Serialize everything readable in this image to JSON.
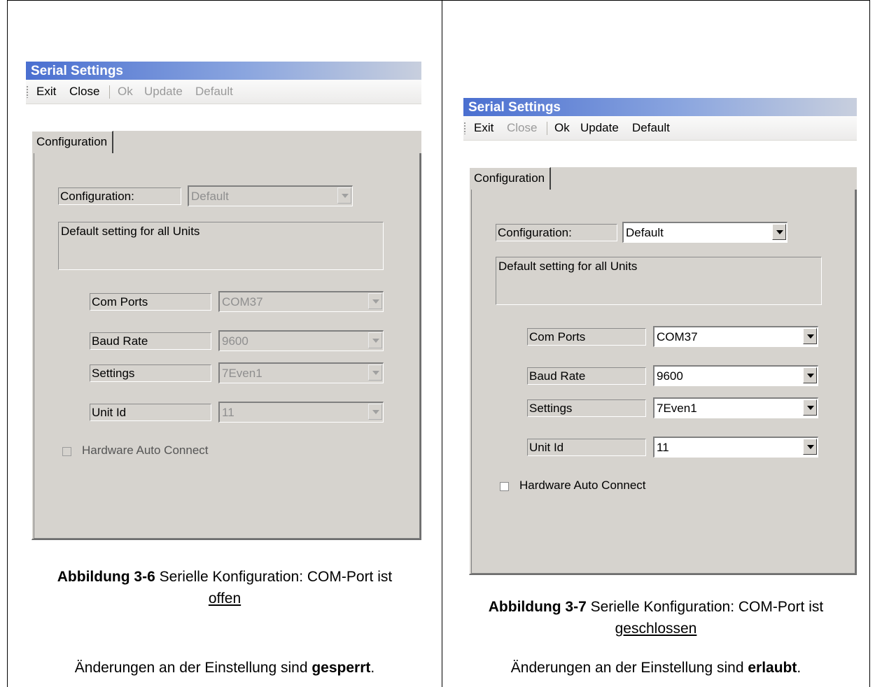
{
  "left": {
    "window_title": "Serial Settings",
    "toolbar": {
      "exit": "Exit",
      "close": "Close",
      "ok": "Ok",
      "update": "Update",
      "default": "Default"
    },
    "tab": "Configuration",
    "configuration_label": "Configuration:",
    "configuration_value": "Default",
    "description": "Default setting for all Units",
    "fields": [
      {
        "label": "Com Ports",
        "value": "COM37"
      },
      {
        "label": "Baud Rate",
        "value": "9600"
      },
      {
        "label": "Settings",
        "value": "7Even1"
      },
      {
        "label": "Unit Id",
        "value": "11"
      }
    ],
    "checkbox": "Hardware Auto Connect",
    "caption_bold": "Abbildung 3-6",
    "caption_text": " Serielle Konfiguration: COM-Port ist",
    "caption_underline": "offen",
    "note_text": "Änderungen an der Einstellung sind ",
    "note_bold": "gesperrt",
    "note_end": "."
  },
  "right": {
    "window_title": "Serial Settings",
    "toolbar": {
      "exit": "Exit",
      "close": "Close",
      "ok": "Ok",
      "update": "Update",
      "default": "Default"
    },
    "tab": "Configuration",
    "configuration_label": "Configuration:",
    "configuration_value": "Default",
    "description": "Default setting for all Units",
    "fields": [
      {
        "label": "Com Ports",
        "value": "COM37"
      },
      {
        "label": "Baud Rate",
        "value": "9600"
      },
      {
        "label": "Settings",
        "value": "7Even1"
      },
      {
        "label": "Unit Id",
        "value": "11"
      }
    ],
    "checkbox": "Hardware Auto Connect",
    "caption_bold": "Abbildung 3-7",
    "caption_text": " Serielle Konfiguration: COM-Port ist",
    "caption_underline": "geschlossen",
    "note_text": "Änderungen an der Einstellung sind ",
    "note_bold": "erlaubt",
    "note_end": "."
  }
}
